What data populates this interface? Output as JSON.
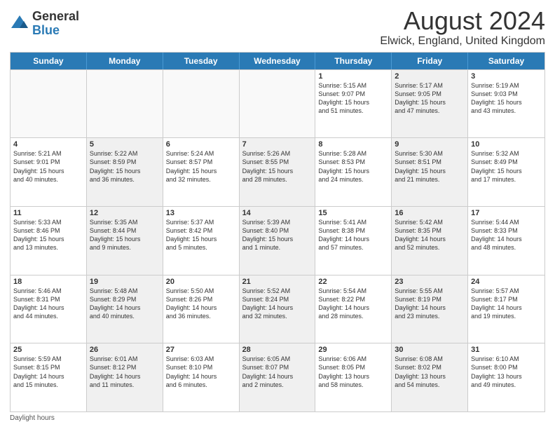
{
  "header": {
    "logo": {
      "general": "General",
      "blue": "Blue"
    },
    "title": "August 2024",
    "location": "Elwick, England, United Kingdom"
  },
  "days": [
    "Sunday",
    "Monday",
    "Tuesday",
    "Wednesday",
    "Thursday",
    "Friday",
    "Saturday"
  ],
  "rows": [
    [
      {
        "day": "",
        "content": "",
        "empty": true
      },
      {
        "day": "",
        "content": "",
        "empty": true
      },
      {
        "day": "",
        "content": "",
        "empty": true
      },
      {
        "day": "",
        "content": "",
        "empty": true
      },
      {
        "day": "1",
        "content": "Sunrise: 5:15 AM\nSunset: 9:07 PM\nDaylight: 15 hours\nand 51 minutes.",
        "empty": false,
        "shaded": false
      },
      {
        "day": "2",
        "content": "Sunrise: 5:17 AM\nSunset: 9:05 PM\nDaylight: 15 hours\nand 47 minutes.",
        "empty": false,
        "shaded": true
      },
      {
        "day": "3",
        "content": "Sunrise: 5:19 AM\nSunset: 9:03 PM\nDaylight: 15 hours\nand 43 minutes.",
        "empty": false,
        "shaded": false
      }
    ],
    [
      {
        "day": "4",
        "content": "Sunrise: 5:21 AM\nSunset: 9:01 PM\nDaylight: 15 hours\nand 40 minutes.",
        "empty": false,
        "shaded": false
      },
      {
        "day": "5",
        "content": "Sunrise: 5:22 AM\nSunset: 8:59 PM\nDaylight: 15 hours\nand 36 minutes.",
        "empty": false,
        "shaded": true
      },
      {
        "day": "6",
        "content": "Sunrise: 5:24 AM\nSunset: 8:57 PM\nDaylight: 15 hours\nand 32 minutes.",
        "empty": false,
        "shaded": false
      },
      {
        "day": "7",
        "content": "Sunrise: 5:26 AM\nSunset: 8:55 PM\nDaylight: 15 hours\nand 28 minutes.",
        "empty": false,
        "shaded": true
      },
      {
        "day": "8",
        "content": "Sunrise: 5:28 AM\nSunset: 8:53 PM\nDaylight: 15 hours\nand 24 minutes.",
        "empty": false,
        "shaded": false
      },
      {
        "day": "9",
        "content": "Sunrise: 5:30 AM\nSunset: 8:51 PM\nDaylight: 15 hours\nand 21 minutes.",
        "empty": false,
        "shaded": true
      },
      {
        "day": "10",
        "content": "Sunrise: 5:32 AM\nSunset: 8:49 PM\nDaylight: 15 hours\nand 17 minutes.",
        "empty": false,
        "shaded": false
      }
    ],
    [
      {
        "day": "11",
        "content": "Sunrise: 5:33 AM\nSunset: 8:46 PM\nDaylight: 15 hours\nand 13 minutes.",
        "empty": false,
        "shaded": false
      },
      {
        "day": "12",
        "content": "Sunrise: 5:35 AM\nSunset: 8:44 PM\nDaylight: 15 hours\nand 9 minutes.",
        "empty": false,
        "shaded": true
      },
      {
        "day": "13",
        "content": "Sunrise: 5:37 AM\nSunset: 8:42 PM\nDaylight: 15 hours\nand 5 minutes.",
        "empty": false,
        "shaded": false
      },
      {
        "day": "14",
        "content": "Sunrise: 5:39 AM\nSunset: 8:40 PM\nDaylight: 15 hours\nand 1 minute.",
        "empty": false,
        "shaded": true
      },
      {
        "day": "15",
        "content": "Sunrise: 5:41 AM\nSunset: 8:38 PM\nDaylight: 14 hours\nand 57 minutes.",
        "empty": false,
        "shaded": false
      },
      {
        "day": "16",
        "content": "Sunrise: 5:42 AM\nSunset: 8:35 PM\nDaylight: 14 hours\nand 52 minutes.",
        "empty": false,
        "shaded": true
      },
      {
        "day": "17",
        "content": "Sunrise: 5:44 AM\nSunset: 8:33 PM\nDaylight: 14 hours\nand 48 minutes.",
        "empty": false,
        "shaded": false
      }
    ],
    [
      {
        "day": "18",
        "content": "Sunrise: 5:46 AM\nSunset: 8:31 PM\nDaylight: 14 hours\nand 44 minutes.",
        "empty": false,
        "shaded": false
      },
      {
        "day": "19",
        "content": "Sunrise: 5:48 AM\nSunset: 8:29 PM\nDaylight: 14 hours\nand 40 minutes.",
        "empty": false,
        "shaded": true
      },
      {
        "day": "20",
        "content": "Sunrise: 5:50 AM\nSunset: 8:26 PM\nDaylight: 14 hours\nand 36 minutes.",
        "empty": false,
        "shaded": false
      },
      {
        "day": "21",
        "content": "Sunrise: 5:52 AM\nSunset: 8:24 PM\nDaylight: 14 hours\nand 32 minutes.",
        "empty": false,
        "shaded": true
      },
      {
        "day": "22",
        "content": "Sunrise: 5:54 AM\nSunset: 8:22 PM\nDaylight: 14 hours\nand 28 minutes.",
        "empty": false,
        "shaded": false
      },
      {
        "day": "23",
        "content": "Sunrise: 5:55 AM\nSunset: 8:19 PM\nDaylight: 14 hours\nand 23 minutes.",
        "empty": false,
        "shaded": true
      },
      {
        "day": "24",
        "content": "Sunrise: 5:57 AM\nSunset: 8:17 PM\nDaylight: 14 hours\nand 19 minutes.",
        "empty": false,
        "shaded": false
      }
    ],
    [
      {
        "day": "25",
        "content": "Sunrise: 5:59 AM\nSunset: 8:15 PM\nDaylight: 14 hours\nand 15 minutes.",
        "empty": false,
        "shaded": false
      },
      {
        "day": "26",
        "content": "Sunrise: 6:01 AM\nSunset: 8:12 PM\nDaylight: 14 hours\nand 11 minutes.",
        "empty": false,
        "shaded": true
      },
      {
        "day": "27",
        "content": "Sunrise: 6:03 AM\nSunset: 8:10 PM\nDaylight: 14 hours\nand 6 minutes.",
        "empty": false,
        "shaded": false
      },
      {
        "day": "28",
        "content": "Sunrise: 6:05 AM\nSunset: 8:07 PM\nDaylight: 14 hours\nand 2 minutes.",
        "empty": false,
        "shaded": true
      },
      {
        "day": "29",
        "content": "Sunrise: 6:06 AM\nSunset: 8:05 PM\nDaylight: 13 hours\nand 58 minutes.",
        "empty": false,
        "shaded": false
      },
      {
        "day": "30",
        "content": "Sunrise: 6:08 AM\nSunset: 8:02 PM\nDaylight: 13 hours\nand 54 minutes.",
        "empty": false,
        "shaded": true
      },
      {
        "day": "31",
        "content": "Sunrise: 6:10 AM\nSunset: 8:00 PM\nDaylight: 13 hours\nand 49 minutes.",
        "empty": false,
        "shaded": false
      }
    ]
  ],
  "footer": {
    "note": "Daylight hours"
  }
}
